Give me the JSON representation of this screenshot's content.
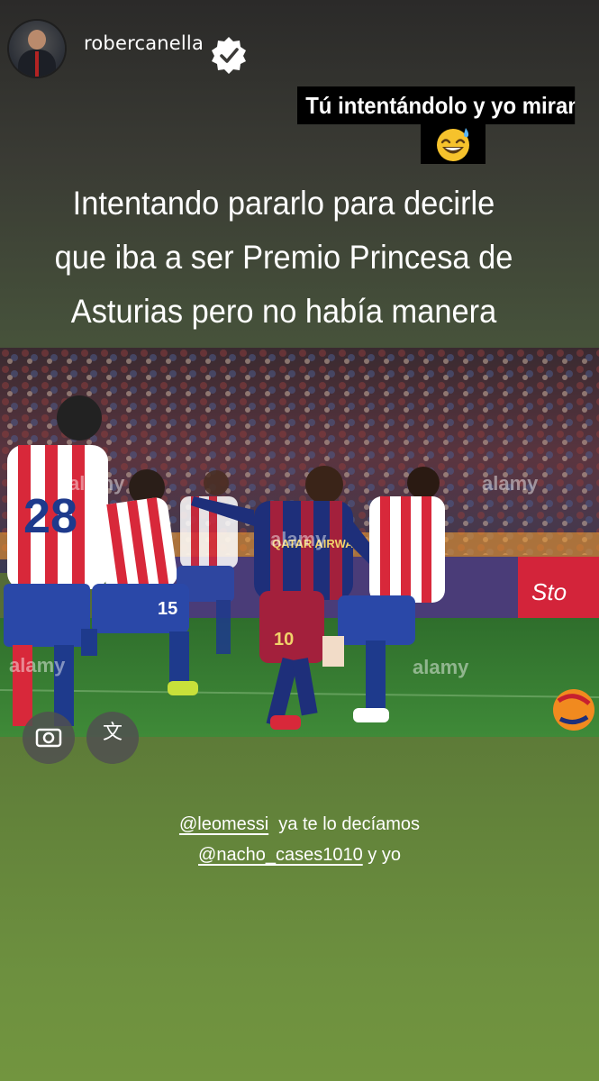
{
  "story": {
    "username": "robercanella",
    "verified": true,
    "sticker_text": "Tú intentándolo y yo mirando..",
    "sticker_emoji": "sweat-smile-emoji",
    "caption_lines": [
      "Intentando pararlo para decirle",
      "que iba a ser Premio Princesa de",
      "Asturias pero no había manera"
    ],
    "photo": {
      "watermark": "alamy",
      "jersey_numbers": [
        "28",
        "15",
        "10"
      ],
      "shirt_sponsor": "QATAR AIRWAYS"
    },
    "mentions_line1": {
      "mention": "@leomessi",
      "text": "ya te lo decíamos"
    },
    "mentions_line2": {
      "mention": "@nacho_cases1010",
      "text": "y yo"
    }
  },
  "colors": {
    "sticker_bg": "#000000",
    "text": "#ffffff",
    "pitch": "#3f7a35",
    "barca_blue": "#1e2f7a",
    "barca_red": "#a3203c",
    "sporting_red": "#d8283a"
  }
}
